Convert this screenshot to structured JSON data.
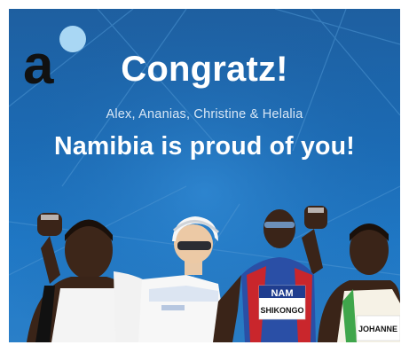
{
  "card": {
    "headline": "Congratz!",
    "names": "Alex,  Ananias, Christine & Helalia",
    "subheadline": "Namibia is proud of you!"
  },
  "logo": {
    "letter": "a"
  },
  "athletes": {
    "bib_shikongo_country": "NAM",
    "bib_shikongo_name": "SHIKONGO",
    "bib_johannes_name": "JOHANNE"
  },
  "colors": {
    "background_top": "#1e5fa0",
    "background_bottom": "#2a7fc8",
    "logo_dot": "#a9d7f4",
    "text": "#ffffff"
  }
}
